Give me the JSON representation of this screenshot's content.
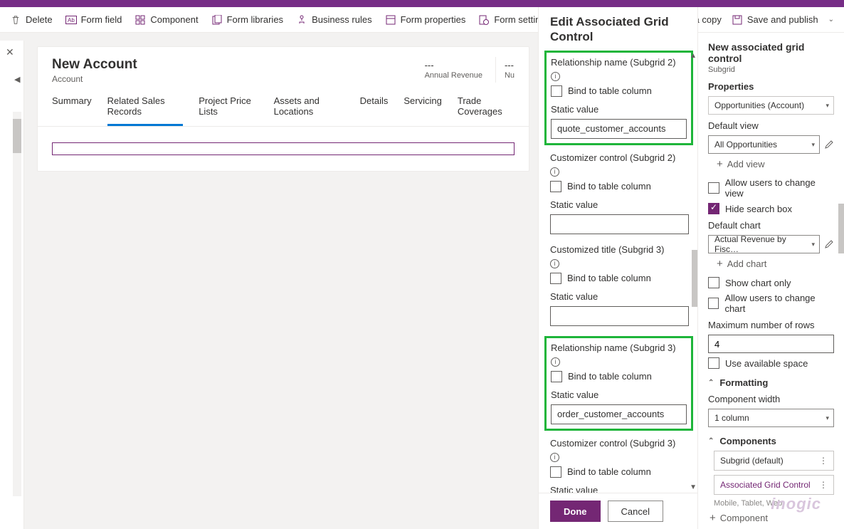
{
  "toolbar": {
    "delete": "Delete",
    "form_field": "Form field",
    "component": "Component",
    "form_libraries": "Form libraries",
    "business_rules": "Business rules",
    "form_properties": "Form properties",
    "form_settings": "Form settings",
    "save_copy": "Save a copy",
    "save_publish": "Save and publish"
  },
  "form": {
    "title": "New Account",
    "entity": "Account",
    "meta": [
      {
        "value": "---",
        "label": "Annual Revenue"
      },
      {
        "value": "---",
        "label": "Nu"
      }
    ],
    "tabs": [
      "Summary",
      "Related Sales Records",
      "Project Price Lists",
      "Assets and Locations",
      "Details",
      "Servicing",
      "Trade Coverages"
    ],
    "active_tab": 1
  },
  "edit": {
    "title": "Edit Associated Grid Control",
    "groups": [
      {
        "title": "Relationship name (Subgrid 2)",
        "info": true,
        "hl": true,
        "bind": "Bind to table column",
        "sv_label": "Static value",
        "sv": "quote_customer_accounts"
      },
      {
        "title": "Customizer control (Subgrid 2)",
        "info": true,
        "hl": false,
        "bind": "Bind to table column",
        "sv_label": "Static value",
        "sv": ""
      },
      {
        "title": "Customized title (Subgrid 3)",
        "info": true,
        "hl": false,
        "bind": "Bind to table column",
        "sv_label": "Static value",
        "sv": ""
      },
      {
        "title": "Relationship name (Subgrid 3)",
        "info": true,
        "hl": true,
        "bind": "Bind to table column",
        "sv_label": "Static value",
        "sv": "order_customer_accounts"
      },
      {
        "title": "Customizer control (Subgrid 3)",
        "info": true,
        "hl": false,
        "bind": "Bind to table column",
        "sv_label": "Static value",
        "sv": "",
        "cut": true
      }
    ],
    "done": "Done",
    "cancel": "Cancel"
  },
  "right": {
    "title": "New associated grid control",
    "sub": "Subgrid",
    "properties": "Properties",
    "table_dd": "Opportunities (Account)",
    "default_view": "Default view",
    "dv_dd": "All Opportunities",
    "add_view": "Add view",
    "allow_view": "Allow users to change view",
    "hide_search": "Hide search box",
    "default_chart": "Default chart",
    "dc_dd": "Actual Revenue by Fisc…",
    "add_chart": "Add chart",
    "show_chart": "Show chart only",
    "allow_chart": "Allow users to change chart",
    "max_rows": "Maximum number of rows",
    "max_rows_v": "4",
    "use_space": "Use available space",
    "formatting": "Formatting",
    "comp_width": "Component width",
    "cw_dd": "1 column",
    "components": "Components",
    "comp_items": [
      "Subgrid (default)",
      "Associated Grid Control"
    ],
    "devices": "Mobile, Tablet, Web",
    "add_comp": "Component"
  },
  "watermark": "inogic"
}
